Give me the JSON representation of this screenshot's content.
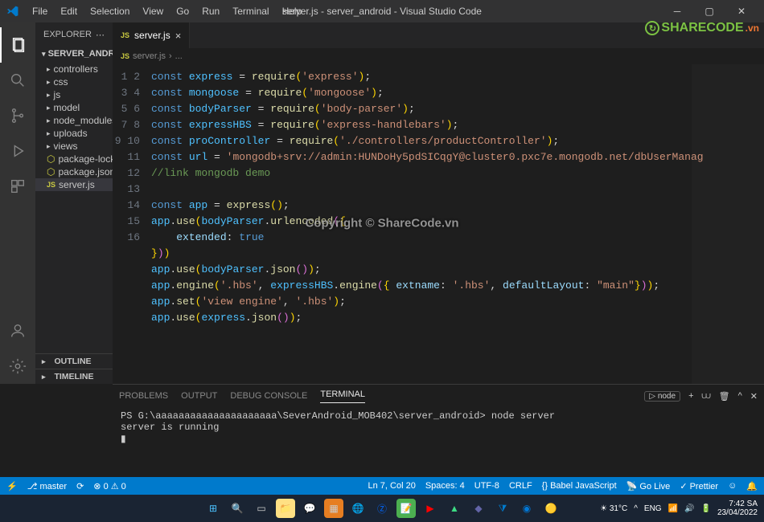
{
  "titlebar": {
    "menu": [
      "File",
      "Edit",
      "Selection",
      "View",
      "Go",
      "Run",
      "Terminal",
      "Help"
    ],
    "title": "server.js - server_android - Visual Studio Code"
  },
  "activity": {
    "items": [
      "files",
      "search",
      "source-control",
      "debug",
      "extensions"
    ],
    "bottom": [
      "account",
      "settings"
    ]
  },
  "sidebar": {
    "header": "EXPLORER",
    "project": "SERVER_ANDROID",
    "tree": [
      {
        "type": "folder",
        "label": "controllers"
      },
      {
        "type": "folder",
        "label": "css"
      },
      {
        "type": "folder",
        "label": "js"
      },
      {
        "type": "folder",
        "label": "model"
      },
      {
        "type": "folder",
        "label": "node_modules"
      },
      {
        "type": "folder",
        "label": "uploads"
      },
      {
        "type": "folder",
        "label": "views"
      },
      {
        "type": "json",
        "label": "package-lock.json"
      },
      {
        "type": "json",
        "label": "package.json"
      },
      {
        "type": "js",
        "label": "server.js",
        "active": true
      }
    ],
    "outline": "OUTLINE",
    "timeline": "TIMELINE"
  },
  "tabs": {
    "active": {
      "icon": "JS",
      "label": "server.js"
    }
  },
  "breadcrumb": {
    "file": "server.js",
    "sep": "›",
    "more": "..."
  },
  "code": {
    "lines": [
      1,
      2,
      3,
      4,
      5,
      6,
      7,
      8,
      9,
      10,
      11,
      12,
      13,
      14,
      15,
      16
    ]
  },
  "panel": {
    "tabs": [
      "PROBLEMS",
      "OUTPUT",
      "DEBUG CONSOLE",
      "TERMINAL"
    ],
    "active": 3,
    "shell_label": "node",
    "terminal": "PS G:\\aaaaaaaaaaaaaaaaaaaaa\\SeverAndroid_MOB402\\server_android> node server\nserver is running\n▮"
  },
  "statusbar": {
    "branch": "master",
    "errors": "0",
    "warnings": "0",
    "ln": "Ln 7, Col 20",
    "spaces": "Spaces: 4",
    "encoding": "UTF-8",
    "eol": "CRLF",
    "lang": "Babel JavaScript",
    "golive": "Go Live",
    "prettier": "Prettier",
    "bell": "🔔"
  },
  "taskbar": {
    "tray": {
      "weather": "31°C",
      "lang": "ENG",
      "time": "7:42 SA",
      "date": "23/04/2022"
    }
  },
  "watermark": "Copyright © ShareCode.vn",
  "logo": {
    "main": "SHARECODE",
    "suffix": ".vn"
  }
}
